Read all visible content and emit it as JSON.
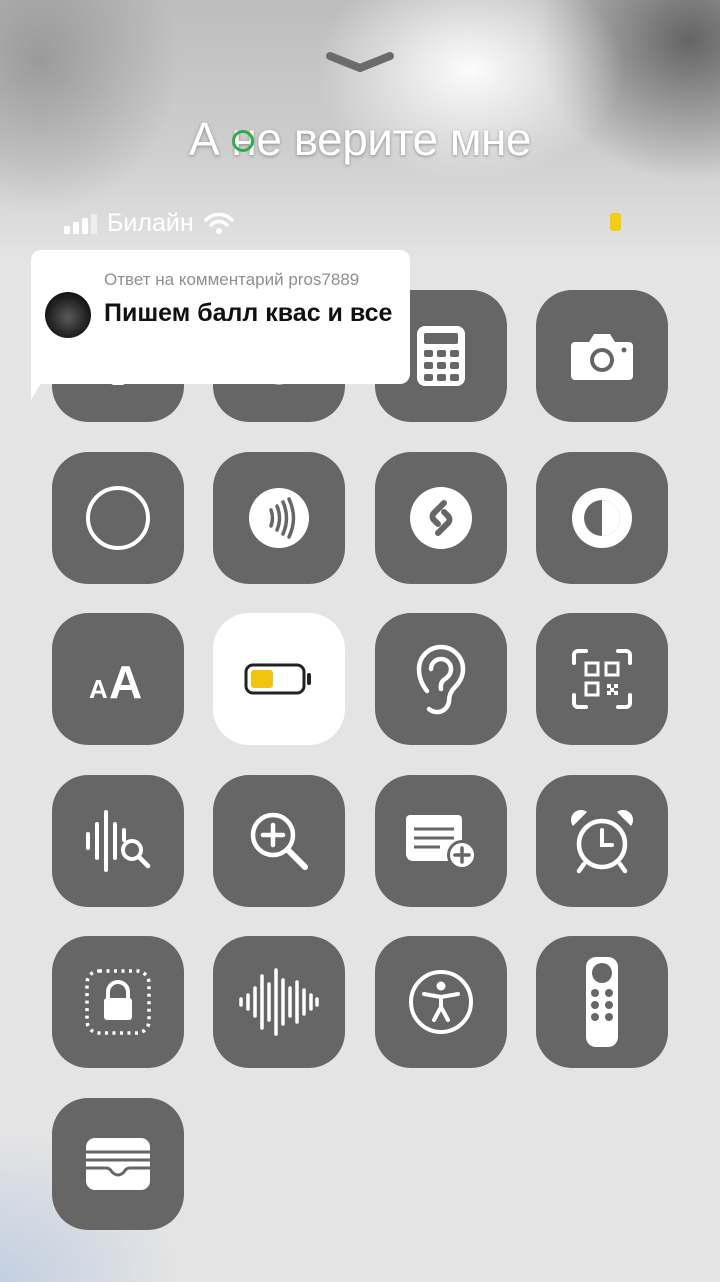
{
  "caption": {
    "text": "А не верите мне"
  },
  "status_bar": {
    "carrier": "Билайн"
  },
  "comment_bubble": {
    "meta": "Ответ на комментарий pros7889",
    "text": "Пишем балл квас и все"
  },
  "colors": {
    "tile_background": "#666666",
    "tile_active": "#ffffff",
    "battery_fill": "#f2c40c",
    "accent_green": "#2fae48"
  },
  "control_tiles": [
    {
      "icon": "flashlight-icon"
    },
    {
      "icon": "timer-icon"
    },
    {
      "icon": "calculator-icon"
    },
    {
      "icon": "camera-icon"
    },
    {
      "icon": "screen-record-icon"
    },
    {
      "icon": "nfc-icon"
    },
    {
      "icon": "shazam-icon"
    },
    {
      "icon": "dark-mode-icon"
    },
    {
      "icon": "text-size-icon"
    },
    {
      "icon": "low-power-mode-icon",
      "active": true
    },
    {
      "icon": "hearing-icon"
    },
    {
      "icon": "qr-code-scanner-icon"
    },
    {
      "icon": "sound-recognition-icon"
    },
    {
      "icon": "magnifier-icon"
    },
    {
      "icon": "quick-note-icon"
    },
    {
      "icon": "alarm-icon"
    },
    {
      "icon": "guided-access-icon"
    },
    {
      "icon": "voice-memos-icon"
    },
    {
      "icon": "accessibility-icon"
    },
    {
      "icon": "apple-tv-remote-icon"
    },
    {
      "icon": "wallet-icon"
    }
  ]
}
